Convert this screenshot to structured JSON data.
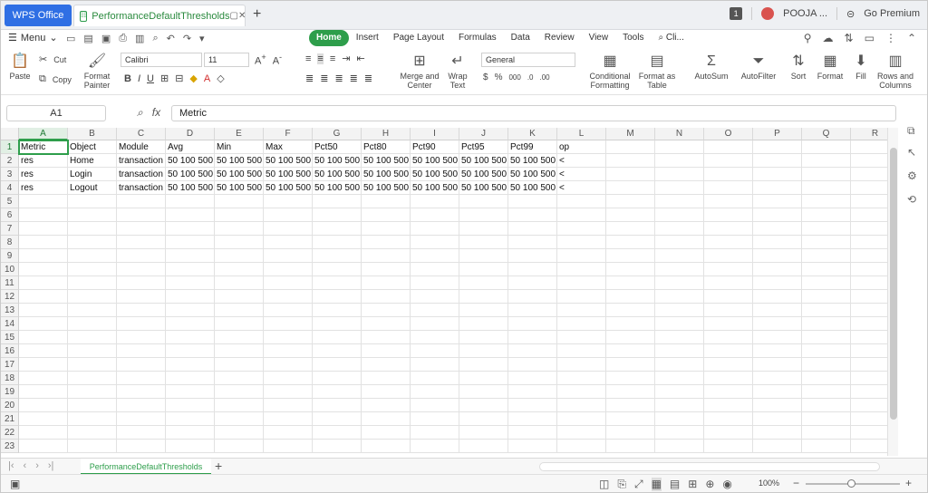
{
  "tabs": {
    "app_label": "WPS Office",
    "doc_title": "PerformanceDefaultThresholds",
    "notif_count": "1",
    "user_name": "POOJA ...",
    "premium_label": "Go Premium"
  },
  "menu": {
    "menu_label": "Menu",
    "tabs": [
      "Home",
      "Insert",
      "Page Layout",
      "Formulas",
      "Data",
      "Review",
      "View",
      "Tools",
      "Cli..."
    ],
    "active_tab": "Home"
  },
  "ribbon": {
    "paste": "Paste",
    "cut": "Cut",
    "copy": "Copy",
    "format_painter_1": "Format",
    "format_painter_2": "Painter",
    "font": "Calibri",
    "font_size": "11",
    "merge_1": "Merge and",
    "merge_2": "Center",
    "wrap_1": "Wrap",
    "wrap_2": "Text",
    "number_format": "General",
    "cond_1": "Conditional",
    "cond_2": "Formatting",
    "fat_1": "Format as",
    "fat_2": "Table",
    "autosum": "AutoSum",
    "autofilter": "AutoFilter",
    "sort": "Sort",
    "format": "Format",
    "fill": "Fill",
    "rows_cols_1": "Rows and",
    "rows_cols_2": "Columns"
  },
  "formula_bar": {
    "cell_ref": "A1",
    "content": "Metric"
  },
  "sheet": {
    "columns": [
      "A",
      "B",
      "C",
      "D",
      "E",
      "F",
      "G",
      "H",
      "I",
      "J",
      "K",
      "L",
      "M",
      "N",
      "O",
      "P",
      "Q",
      "R"
    ],
    "row_count": 23,
    "rows": [
      [
        "Metric",
        "Object",
        "Module",
        "Avg",
        "Min",
        "Max",
        "Pct50",
        "Pct80",
        "Pct90",
        "Pct95",
        "Pct99",
        "op"
      ],
      [
        "res",
        "Home",
        "transaction",
        "50 100 500",
        "50 100 500",
        "50 100 500",
        "50 100 500",
        "50 100 500",
        "50 100 500",
        "50 100 500",
        "50 100 500",
        "<"
      ],
      [
        "res",
        "Login",
        "transaction",
        "50 100 500",
        "50 100 500",
        "50 100 500",
        "50 100 500",
        "50 100 500",
        "50 100 500",
        "50 100 500",
        "50 100 500",
        "<"
      ],
      [
        "res",
        "Logout",
        "transaction",
        "50 100 500",
        "50 100 500",
        "50 100 500",
        "50 100 500",
        "50 100 500",
        "50 100 500",
        "50 100 500",
        "50 100 500",
        "<"
      ]
    ]
  },
  "sheet_tab": "PerformanceDefaultThresholds",
  "status": {
    "zoom": "100%"
  }
}
